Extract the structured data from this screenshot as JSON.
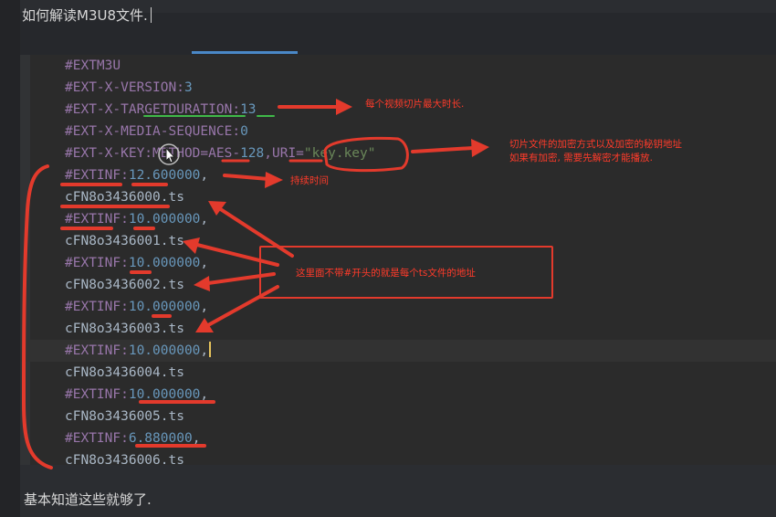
{
  "title": "如何解读M3U8文件.",
  "code_lines": [
    {
      "tokens": [
        {
          "t": "#EXTM3U",
          "c": "tag"
        }
      ]
    },
    {
      "tokens": [
        {
          "t": "#EXT-X-VERSION:",
          "c": "tag"
        },
        {
          "t": "3",
          "c": "num"
        }
      ]
    },
    {
      "tokens": [
        {
          "t": "#EXT-X-TARGETDURATION:",
          "c": "tag"
        },
        {
          "t": "13",
          "c": "num"
        }
      ]
    },
    {
      "tokens": [
        {
          "t": "#EXT-X-MEDIA-SEQUENCE:",
          "c": "tag"
        },
        {
          "t": "0",
          "c": "num"
        }
      ]
    },
    {
      "tokens": [
        {
          "t": "#EXT-X-KEY:METHOD=AES-",
          "c": "tag"
        },
        {
          "t": "128",
          "c": "num"
        },
        {
          "t": ",URI=",
          "c": "tag"
        },
        {
          "t": "\"key.key\"",
          "c": "str"
        }
      ]
    },
    {
      "tokens": [
        {
          "t": "#EXTINF:",
          "c": "tag"
        },
        {
          "t": "12.600000",
          "c": "num"
        },
        {
          "t": ",",
          "c": "plain"
        }
      ]
    },
    {
      "tokens": [
        {
          "t": "cFN8o3436000.ts",
          "c": "plain"
        }
      ]
    },
    {
      "tokens": [
        {
          "t": "#EXTINF:",
          "c": "tag"
        },
        {
          "t": "10.000000",
          "c": "num"
        },
        {
          "t": ",",
          "c": "plain"
        }
      ]
    },
    {
      "tokens": [
        {
          "t": "cFN8o3436001.ts",
          "c": "plain"
        }
      ]
    },
    {
      "tokens": [
        {
          "t": "#EXTINF:",
          "c": "tag"
        },
        {
          "t": "10.000000",
          "c": "num"
        },
        {
          "t": ",",
          "c": "plain"
        }
      ]
    },
    {
      "tokens": [
        {
          "t": "cFN8o3436002.ts",
          "c": "plain"
        }
      ]
    },
    {
      "tokens": [
        {
          "t": "#EXTINF:",
          "c": "tag"
        },
        {
          "t": "10.000000",
          "c": "num"
        },
        {
          "t": ",",
          "c": "plain"
        }
      ]
    },
    {
      "tokens": [
        {
          "t": "cFN8o3436003.ts",
          "c": "plain"
        }
      ]
    },
    {
      "tokens": [
        {
          "t": "#EXTINF:",
          "c": "tag"
        },
        {
          "t": "10.000000",
          "c": "num"
        },
        {
          "t": ",",
          "c": "plain"
        }
      ],
      "current": true
    },
    {
      "tokens": [
        {
          "t": "cFN8o3436004.ts",
          "c": "plain"
        }
      ]
    },
    {
      "tokens": [
        {
          "t": "#EXTINF:",
          "c": "tag"
        },
        {
          "t": "10.000000",
          "c": "num"
        },
        {
          "t": ",",
          "c": "plain"
        }
      ]
    },
    {
      "tokens": [
        {
          "t": "cFN8o3436005.ts",
          "c": "plain"
        }
      ]
    },
    {
      "tokens": [
        {
          "t": "#EXTINF:",
          "c": "tag"
        },
        {
          "t": "6.880000",
          "c": "num"
        },
        {
          "t": ",",
          "c": "plain"
        }
      ]
    },
    {
      "tokens": [
        {
          "t": "cFN8o3436006.ts",
          "c": "plain"
        }
      ]
    }
  ],
  "annotations": {
    "target_duration": "每个视频切片最大时长.",
    "key_line1": "切片文件的加密方式以及加密的秘钥地址",
    "key_line2": "如果有加密, 需要先解密才能播放.",
    "duration": "持续时间",
    "ts_files": "这里面不带#开头的就是每个ts文件的地址"
  },
  "bottom_text": "基本知道这些就够了.",
  "colors": {
    "annotation": "#e33a2c",
    "tag": "#9876aa",
    "number": "#6897bb",
    "string": "#6a8759",
    "text": "#a9b7c6"
  }
}
